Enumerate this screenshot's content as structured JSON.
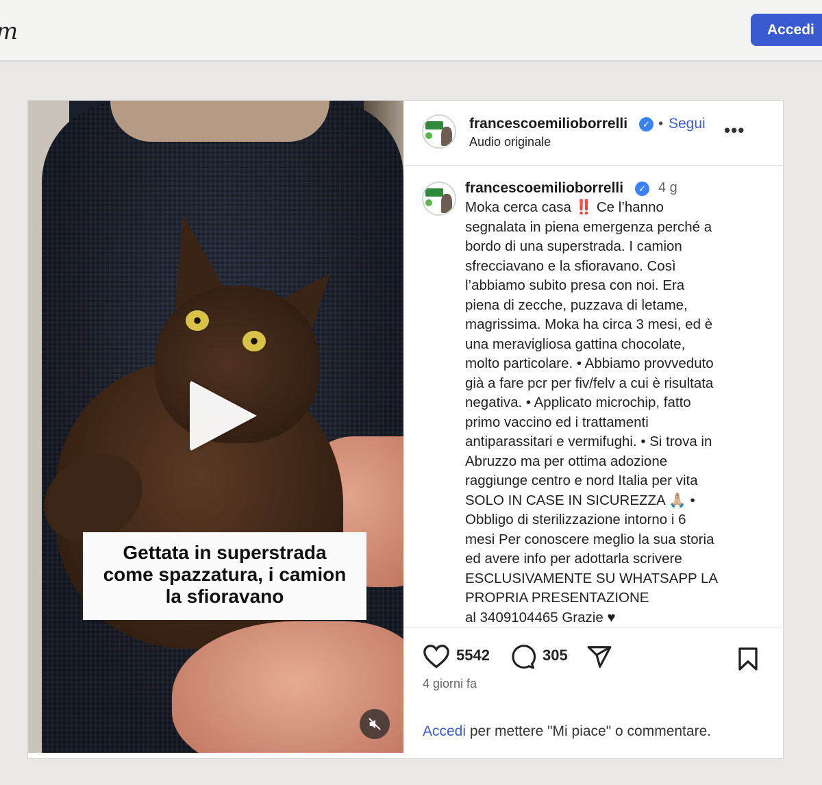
{
  "header": {
    "logo_fragment": "m",
    "login_label": "Accedi"
  },
  "media": {
    "caption_lines": [
      "Gettata in superstrada",
      "come spazzatura, i camion",
      "la sfioravano"
    ]
  },
  "post": {
    "username": "francescoemilioborrelli",
    "follow_label": "Segui",
    "separator": "•",
    "audio_label": "Audio originale",
    "more_label": "•••",
    "time_ago": "4 g",
    "caption_lines": [
      "Moka cerca casa ‼️ Ce l’hanno",
      "segnalata in piena emergenza perché a",
      "bordo di una superstrada. I camion",
      "sfrecciavano e la sfioravano. Così",
      "l’abbiamo subito presa con noi. Era",
      "piena di zecche, puzzava di letame,",
      "magrissima. Moka ha circa 3 mesi, ed è",
      "una meravigliosa gattina chocolate,",
      "molto particolare. • Abbiamo provveduto",
      "già a fare pcr per fiv/felv a cui è risultata",
      "negativa. • Applicato microchip, fatto",
      "primo vaccino ed i trattamenti",
      "antiparassitari e vermifughi. • Si trova in",
      "Abruzzo ma per ottima adozione",
      "raggiunge centro e nord Italia per vita",
      "SOLO IN CASE IN SICUREZZA 🙏🏼 •",
      "Obbligo di sterilizzazione intorno i 6",
      "mesi Per conoscere meglio la sua storia",
      "ed avere info per adottarla scrivere",
      "ESCLUSIVAMENTE SU WHATSAPP LA",
      "PROPRIA PRESENTAZIONE",
      "al 3409104465 Grazie ♥"
    ],
    "likes": "5542",
    "comments": "305",
    "date_ago": "4 giorni fa",
    "login_link": "Accedi",
    "login_prompt_rest": " per mettere \"Mi piace\" o commentare."
  }
}
